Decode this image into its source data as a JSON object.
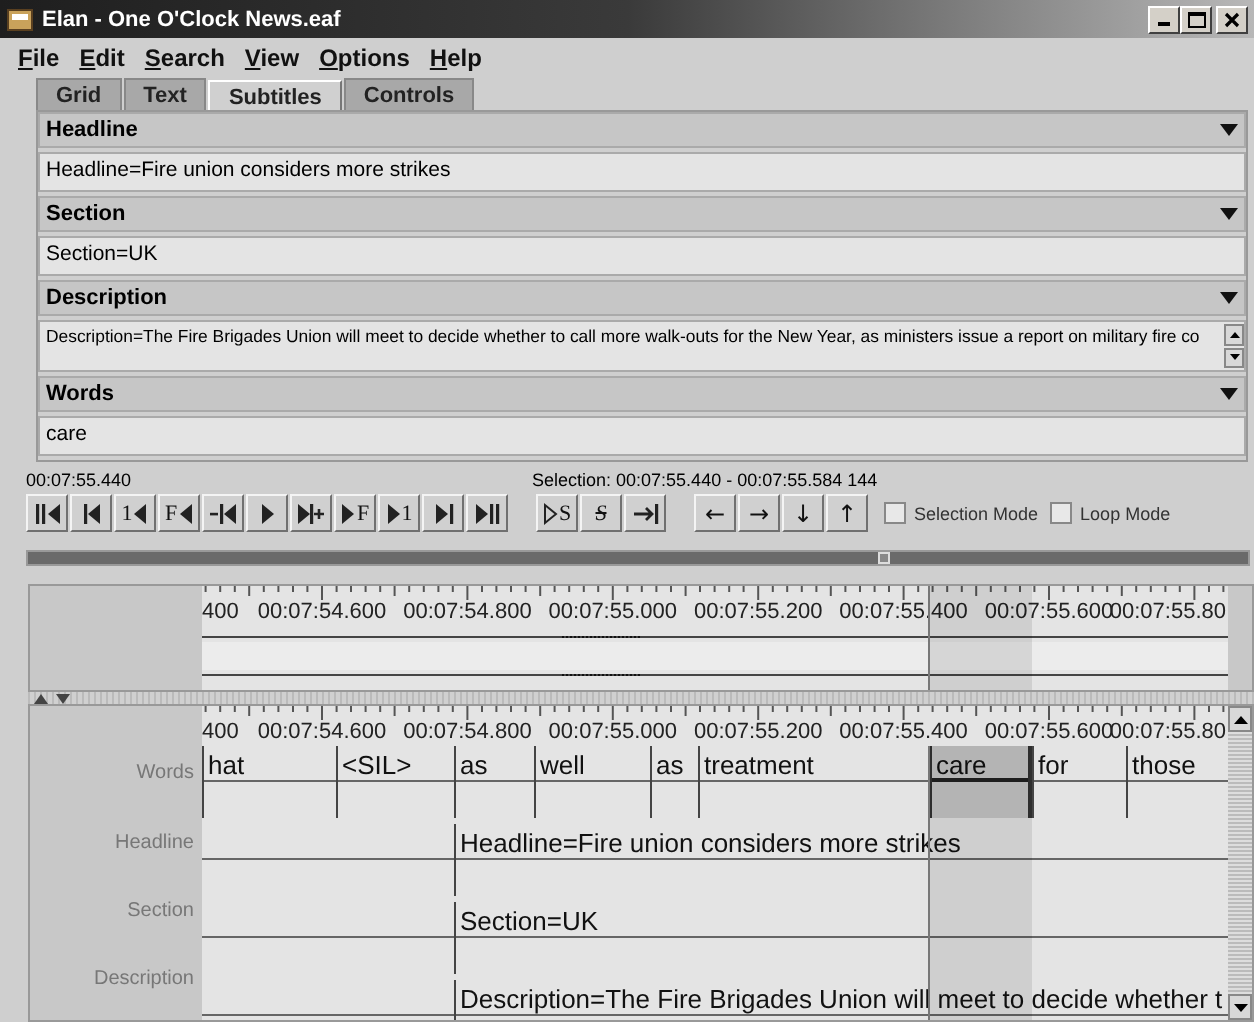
{
  "window": {
    "title": "Elan - One O'Clock News.eaf"
  },
  "menu": [
    "File",
    "Edit",
    "Search",
    "View",
    "Options",
    "Help"
  ],
  "tabs": [
    {
      "label": "Grid",
      "selected": false
    },
    {
      "label": "Text",
      "selected": false
    },
    {
      "label": "Subtitles",
      "selected": true
    },
    {
      "label": "Controls",
      "selected": false
    }
  ],
  "subtitles": [
    {
      "tier": "Headline",
      "value": "Headline=Fire union considers more strikes"
    },
    {
      "tier": "Section",
      "value": "Section=UK"
    },
    {
      "tier": "Description",
      "value": "Description=The Fire Brigades Union will meet to decide whether to call more walk-outs for the New Year, as ministers issue a report on military fire co"
    },
    {
      "tier": "Words",
      "value": "care"
    }
  ],
  "controls": {
    "time": "00:07:55.440",
    "selection": "Selection: 00:07:55.440 - 00:07:55.584  144",
    "media_buttons": [
      {
        "kind": "to-begin"
      },
      {
        "kind": "prev-boundary"
      },
      {
        "kind": "back-one",
        "text": "1"
      },
      {
        "kind": "back-frame",
        "text": "F"
      },
      {
        "kind": "back-step"
      },
      {
        "kind": "play"
      },
      {
        "kind": "play-step"
      },
      {
        "kind": "fwd-frame",
        "text": "F"
      },
      {
        "kind": "fwd-one",
        "text": "1"
      },
      {
        "kind": "next-boundary"
      },
      {
        "kind": "to-end"
      }
    ],
    "selection_buttons": [
      {
        "kind": "play-selection",
        "text": "S"
      },
      {
        "kind": "clear-selection",
        "text": "S"
      },
      {
        "kind": "to-selection-end"
      }
    ],
    "arrow_buttons": [
      "←",
      "→",
      "↓",
      "↑"
    ],
    "checkboxes": [
      {
        "label": "Selection Mode",
        "checked": false
      },
      {
        "label": "Loop Mode",
        "checked": false
      }
    ]
  },
  "slider": {
    "level": 0.7
  },
  "upper_timeline": {
    "ruler_labels": [
      "400",
      "00:07:54.600",
      "00:07:54.800",
      "00:07:55.000",
      "00:07:55.200",
      "00:07:55.400",
      "00:07:55.600",
      "00:07:55.80"
    ]
  },
  "lower_timeline": {
    "ruler_labels": [
      "400",
      "00:07:54.600",
      "00:07:54.800",
      "00:07:55.000",
      "00:07:55.200",
      "00:07:55.400",
      "00:07:55.600",
      "00:07:55.80"
    ],
    "tiers": [
      {
        "name": "Words",
        "annotations": [
          {
            "text": "hat",
            "selected": false
          },
          {
            "text": "<SIL>",
            "selected": false
          },
          {
            "text": "as",
            "selected": false
          },
          {
            "text": "well",
            "selected": false
          },
          {
            "text": "as",
            "selected": false
          },
          {
            "text": "treatment",
            "selected": false
          },
          {
            "text": "care",
            "selected": true
          },
          {
            "text": "for",
            "selected": false
          },
          {
            "text": "those",
            "selected": false
          }
        ]
      },
      {
        "name": "Headline",
        "annotations": [
          {
            "text": "Headline=Fire union considers more strikes",
            "selected": false
          }
        ]
      },
      {
        "name": "Section",
        "annotations": [
          {
            "text": "Section=UK",
            "selected": false
          }
        ]
      },
      {
        "name": "Description",
        "annotations": [
          {
            "text": "Description=The Fire Brigades Union will meet to decide whether t",
            "selected": false
          }
        ]
      }
    ]
  }
}
